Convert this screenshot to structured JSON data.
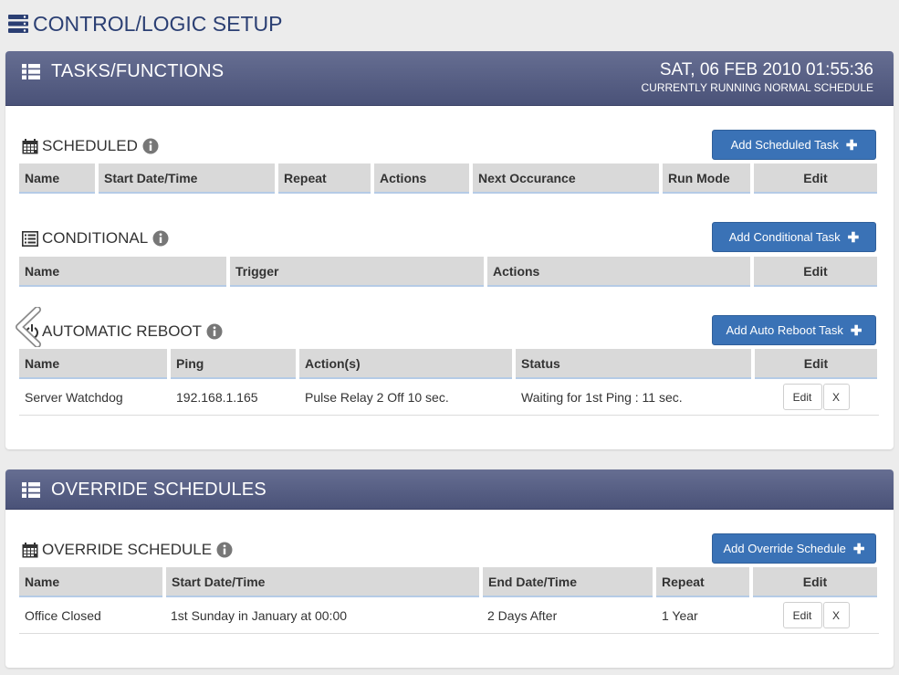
{
  "page": {
    "title": "CONTROL/LOGIC SETUP",
    "title_icon": "server-icon"
  },
  "tasks_panel": {
    "title": "TASKS/FUNCTIONS",
    "datetime": "SAT, 06 FEB 2010 01:55:36",
    "status": "CURRENTLY RUNNING NORMAL SCHEDULE",
    "scheduled": {
      "title": "SCHEDULED",
      "add_button": "Add Scheduled Task",
      "columns": [
        "Name",
        "Start Date/Time",
        "Repeat",
        "Actions",
        "Next Occurance",
        "Run Mode",
        "Edit"
      ]
    },
    "conditional": {
      "title": "CONDITIONAL",
      "add_button": "Add Conditional Task",
      "columns": [
        "Name",
        "Trigger",
        "Actions",
        "Edit"
      ]
    },
    "reboot": {
      "title": "AUTOMATIC REBOOT",
      "add_button": "Add Auto Reboot Task",
      "columns": [
        "Name",
        "Ping",
        "Action(s)",
        "Status",
        "Edit"
      ],
      "rows": [
        {
          "name": "Server Watchdog",
          "ping": "192.168.1.165",
          "action": "Pulse Relay 2 Off 10 sec.",
          "status": "Waiting for 1st Ping : 11 sec.",
          "edit": "Edit",
          "delete": "X"
        }
      ]
    }
  },
  "override_panel": {
    "title": "OVERRIDE SCHEDULES",
    "section": {
      "title": "OVERRIDE SCHEDULE",
      "add_button": "Add Override Schedule",
      "columns": [
        "Name",
        "Start Date/Time",
        "End Date/Time",
        "Repeat",
        "Edit"
      ],
      "rows": [
        {
          "name": "Office Closed",
          "start": "1st Sunday in January at 00:00",
          "end": "2 Days After",
          "repeat": "1 Year",
          "edit": "Edit",
          "delete": "X"
        }
      ]
    }
  },
  "colors": {
    "header": "#545c80",
    "button": "#3a72b6",
    "title": "#2b3f73",
    "info_icon": "#777777"
  }
}
